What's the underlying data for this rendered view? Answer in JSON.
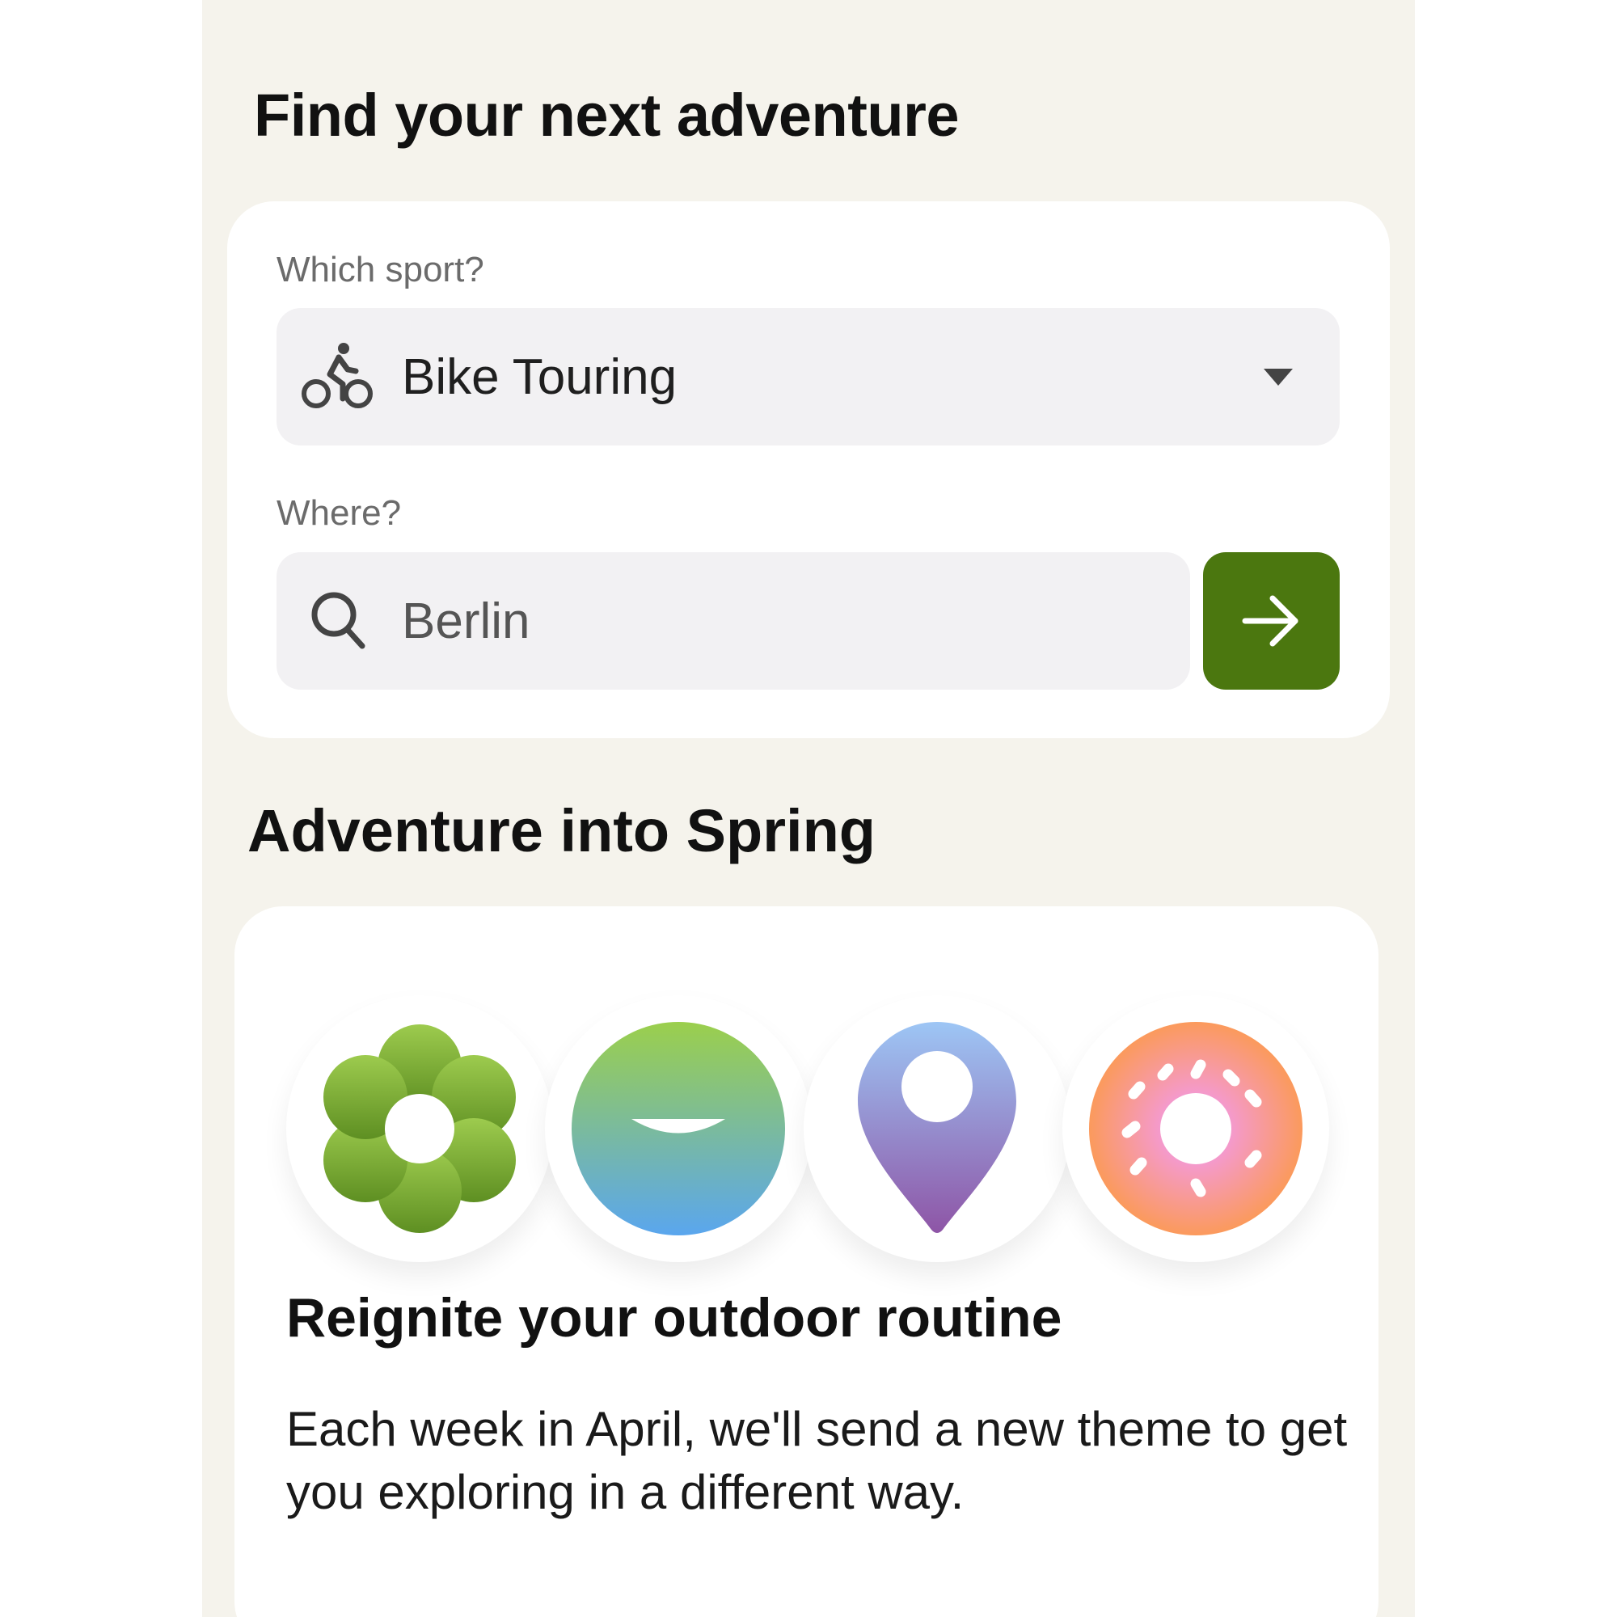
{
  "header": {
    "title": "Find your next adventure"
  },
  "search": {
    "sport_label": "Which sport?",
    "sport_value": "Bike Touring",
    "sport_icon": "bike-icon",
    "where_label": "Where?",
    "where_value": "Berlin",
    "where_icon": "search-icon",
    "go_icon": "arrow-right-icon"
  },
  "section": {
    "title": "Adventure into Spring"
  },
  "promo": {
    "badges": [
      "flower-icon",
      "smile-icon",
      "map-pin-icon",
      "donut-icon"
    ],
    "title": "Reignite your outdoor routine",
    "text": "Each week in April, we'll send a new theme to get you exploring in a different way."
  },
  "colors": {
    "background": "#f5f3ec",
    "card": "#ffffff",
    "input": "#f2f1f3",
    "accent": "#4b770f"
  }
}
